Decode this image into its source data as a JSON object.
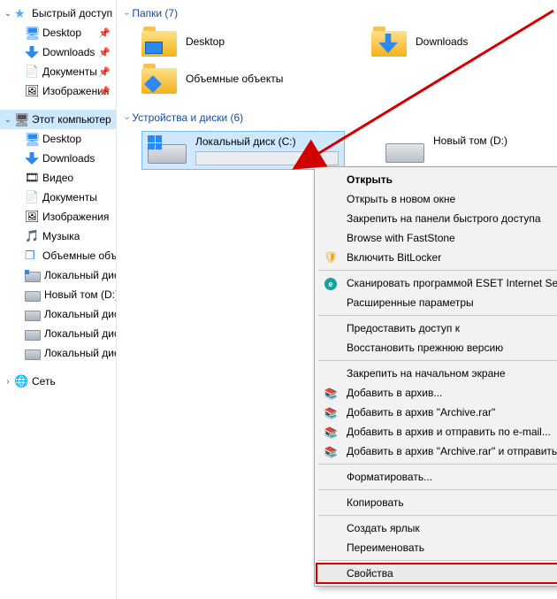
{
  "sidebar": {
    "quick_access": "Быстрый доступ",
    "this_pc": "Этот компьютер",
    "network": "Сеть",
    "items_qa": [
      {
        "icon": "monitor",
        "label": "Desktop",
        "pin": true
      },
      {
        "icon": "down",
        "label": "Downloads",
        "pin": true
      },
      {
        "icon": "doc",
        "label": "Документы",
        "pin": true
      },
      {
        "icon": "img",
        "label": "Изображения",
        "pin": true
      }
    ],
    "items_pc": [
      {
        "icon": "monitor",
        "label": "Desktop"
      },
      {
        "icon": "down",
        "label": "Downloads"
      },
      {
        "icon": "video",
        "label": "Видео"
      },
      {
        "icon": "doc",
        "label": "Документы"
      },
      {
        "icon": "img",
        "label": "Изображения"
      },
      {
        "icon": "music",
        "label": "Музыка"
      },
      {
        "icon": "cube",
        "label": "Объемные объекты"
      },
      {
        "icon": "diskwin",
        "label": "Локальный диск (C:)"
      },
      {
        "icon": "disk",
        "label": "Новый том (D:)"
      },
      {
        "icon": "disk",
        "label": "Локальный диск (E:)"
      },
      {
        "icon": "disk",
        "label": "Локальный диск (F:)"
      },
      {
        "icon": "disk",
        "label": "Локальный диск (G:)"
      }
    ]
  },
  "main": {
    "folders_header": "Папки (7)",
    "drives_header": "Устройства и диски (6)",
    "folders": [
      {
        "kind": "desktop",
        "label": "Desktop"
      },
      {
        "kind": "downloads",
        "label": "Downloads"
      },
      {
        "kind": "objects",
        "label": "Объемные объекты"
      }
    ],
    "drives": [
      {
        "label": "Локальный диск (C:)",
        "selected": true,
        "win": true
      },
      {
        "label": "Новый том (D:)",
        "selected": false,
        "win": false
      }
    ]
  },
  "context_menu": {
    "items": [
      {
        "label": "Открыть",
        "bold": true
      },
      {
        "label": "Открыть в новом окне"
      },
      {
        "label": "Закрепить на панели быстрого доступа"
      },
      {
        "label": "Browse with FastStone"
      },
      {
        "label": "Включить BitLocker",
        "icon": "shield"
      },
      {
        "sep": true
      },
      {
        "label": "Сканировать программой ESET Internet Security",
        "icon": "eset"
      },
      {
        "label": "Расширенные параметры",
        "sub": true
      },
      {
        "sep": true
      },
      {
        "label": "Предоставить доступ к",
        "sub": true
      },
      {
        "label": "Восстановить прежнюю версию"
      },
      {
        "sep": true
      },
      {
        "label": "Закрепить на начальном экране"
      },
      {
        "label": "Добавить в архив...",
        "icon": "books"
      },
      {
        "label": "Добавить в архив \"Archive.rar\"",
        "icon": "books"
      },
      {
        "label": "Добавить в архив и отправить по e-mail...",
        "icon": "books"
      },
      {
        "label": "Добавить в архив \"Archive.rar\" и отправить по e-mail",
        "icon": "books"
      },
      {
        "sep": true
      },
      {
        "label": "Форматировать..."
      },
      {
        "sep": true
      },
      {
        "label": "Копировать"
      },
      {
        "sep": true
      },
      {
        "label": "Создать ярлык"
      },
      {
        "label": "Переименовать"
      },
      {
        "sep": true
      },
      {
        "label": "Свойства",
        "highlight": true
      }
    ]
  }
}
